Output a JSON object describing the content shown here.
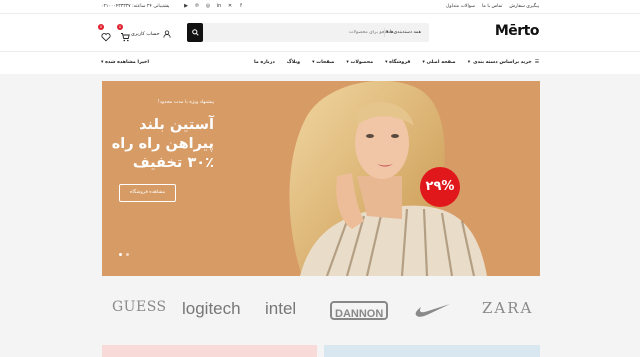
{
  "topbar": {
    "links": [
      "پیگیری سفارش",
      "تماس با ما",
      "سوالات متداول"
    ],
    "phone": "پشتیبانی ۲۴ ساعته: ۰۲۱۰۰۰۴۳۳۳۳۷",
    "social_icons": [
      "facebook-icon",
      "twitter-icon",
      "linkedin-icon",
      "instagram-icon",
      "pinterest-icon",
      "youtube-icon"
    ]
  },
  "header": {
    "logo": "Mērto",
    "search": {
      "category": "همه دسته‌بندی‌ها",
      "placeholder": "جستجو برای محصولات"
    },
    "account": "حساب کاربری",
    "wishlist_count": "0",
    "cart_count": "0"
  },
  "nav": {
    "categories_label": "خرید براساس دسته بندی",
    "items": [
      "صفحه اصلی",
      "فروشگاه",
      "محصولات",
      "صفحات",
      "وبلاگ",
      "درباره ما"
    ],
    "recent_label": "اخیرا مشاهده شده"
  },
  "hero": {
    "promo": "پیشنهاد ویژه با مدت محدود!",
    "headline": [
      "آستین بلند",
      "پیراهن راه راه",
      "۳۰٪ تخفیف"
    ],
    "cta": "مشاهده فروشگاه",
    "badge": "۲۹%",
    "bg_color": "#d79b66"
  },
  "brands": [
    "GUESS",
    "logitech",
    "intel",
    "DANNON",
    "nike-swoosh",
    "ZARA"
  ]
}
